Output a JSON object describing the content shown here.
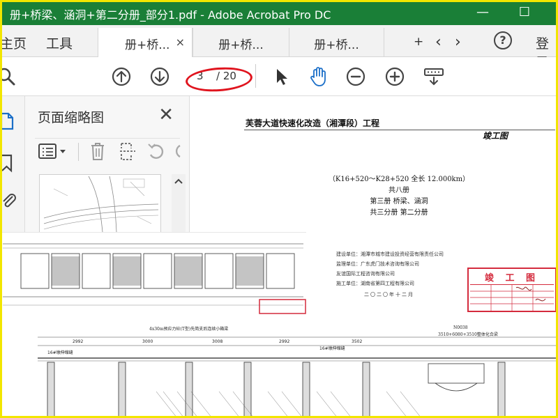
{
  "window": {
    "title": "册+桥梁、涵洞+第二分册_部分1.pdf - Adobe Acrobat Pro DC",
    "minimize_label": "—",
    "maximize_label": "☐"
  },
  "tabbar": {
    "home_label": "主页",
    "tools_label": "工具",
    "tabs": [
      {
        "label": "册+桥...",
        "active": true
      },
      {
        "label": "册+桥...",
        "active": false
      },
      {
        "label": "册+桥...",
        "active": false
      },
      {
        "label": "+",
        "active": false
      }
    ],
    "close_symbol": "×",
    "prev_symbol": "‹",
    "next_symbol": "›",
    "help_symbol": "?",
    "signin_label": "登录"
  },
  "toolbar": {
    "current_page": "3",
    "total_pages": "/ 20",
    "icons": [
      "search-icon",
      "page-up-icon",
      "page-down-icon",
      "select-arrow-icon",
      "hand-icon",
      "zoom-out-icon",
      "zoom-in-icon",
      "keyboard-icon"
    ]
  },
  "thumbnail_panel": {
    "title": "页面缩略图",
    "close_symbol": "✕"
  },
  "document": {
    "project_title": "芙蓉大道快速化改造（湘潭段）工程",
    "stamp_label": "竣工图",
    "station_range": "（K16+520～K28+520  全长 12.000km）",
    "volume": "共八册",
    "book": "第三册  桥梁、涵洞",
    "parts": "共三分册      第二分册",
    "units": [
      "建设单位：湘潭市城市建设投资经营有限责任公司",
      "监理单位：广东虎门技术咨询有限公司",
      "        友谊国际工程咨询有限公司",
      "施工单位：湖南省第四工程有限公司"
    ],
    "date": "二〇二〇年十二月",
    "completion_stamp_label": "竣 工 图"
  },
  "drawing": {
    "labels": {
      "span_title": "4x30m预应力砼(T型)先简支后连续小箱梁",
      "dims_upper": [
        "2992",
        "3000",
        "3008",
        "2992",
        "3502"
      ],
      "left_tag": "16#墩伸缩缝",
      "tag_16": "16#墩伸缩缝",
      "right_title": "3510+6080+3510整体化合梁",
      "right_dim": "N0038"
    }
  },
  "colors": {
    "titlebar": "#1a7f37",
    "highlight_ellipse": "#e0141e",
    "stamp": "#d42a3c",
    "frame": "#f2e600"
  }
}
